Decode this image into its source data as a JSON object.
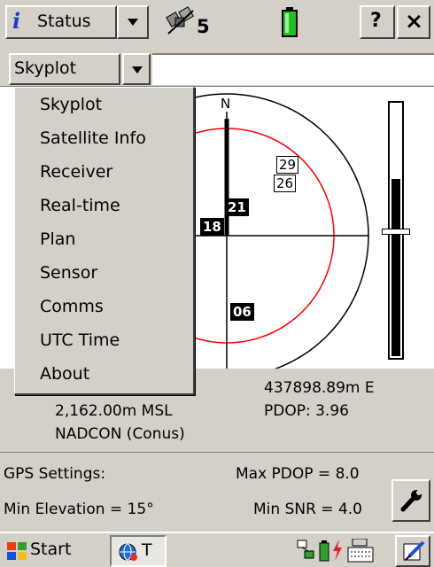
{
  "titlebar": {
    "status_label": "Status",
    "satellite_count": "5",
    "help_label": "?",
    "close_label": "×",
    "icons": [
      "info-icon",
      "dropdown-arrow-icon",
      "satellite-icon",
      "battery-icon"
    ]
  },
  "view_select": {
    "value": "Skyplot"
  },
  "menu": {
    "items": [
      "Skyplot",
      "Satellite Info",
      "Receiver",
      "Real-time",
      "Plan",
      "Sensor",
      "Comms",
      "UTC Time",
      "About"
    ]
  },
  "skyplot": {
    "north_label": "N",
    "satellites": [
      "29",
      "26",
      "21",
      "18",
      "06"
    ],
    "colors": {
      "elevation_ring": "#ff0000",
      "grid": "#000000"
    }
  },
  "position": {
    "easting": "437898.89m E",
    "altitude": "2,162.00m MSL",
    "pdop": "PDOP: 3.96",
    "datum": "NADCON (Conus)"
  },
  "gps_settings": {
    "title": "GPS Settings:",
    "max_pdop": "Max PDOP = 8.0",
    "min_elevation": "Min Elevation = 15°",
    "min_snr": "Min SNR = 4.0"
  },
  "taskbar": {
    "start_label": "Start",
    "task_label": "T",
    "tray_icons": [
      "connection-icon",
      "battery-icon",
      "power-icon",
      "keyboard-icon",
      "edit-icon"
    ]
  }
}
